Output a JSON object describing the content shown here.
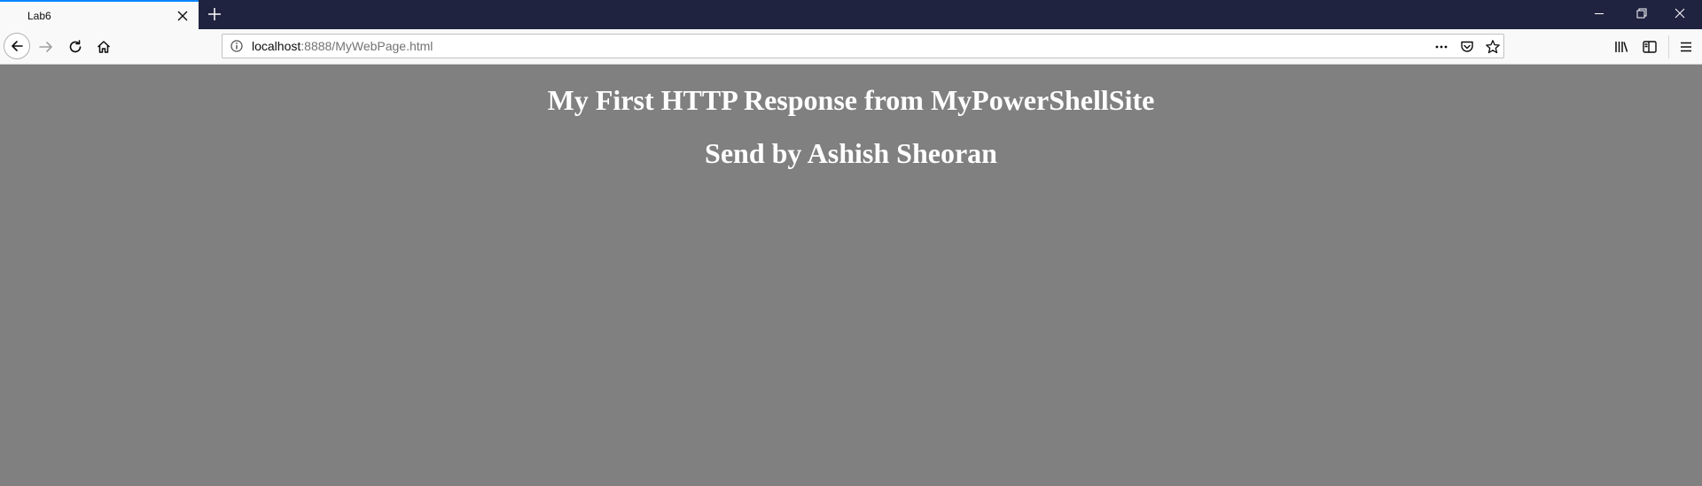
{
  "browser": {
    "tab": {
      "title": "Lab6"
    },
    "url": {
      "host": "localhost",
      "rest": ":8888/MyWebPage.html"
    },
    "colors": {
      "titlebar": "#202340",
      "tab_accent": "#0a84ff",
      "toolbar": "#f9f9fa"
    },
    "icons": {
      "tab_close": "close-icon",
      "new_tab": "plus-icon",
      "minimize": "minimize-icon",
      "restore": "restore-icon",
      "close": "close-icon",
      "back": "arrow-left-icon",
      "forward": "arrow-right-icon",
      "reload": "reload-icon",
      "home": "home-icon",
      "site_info": "info-icon",
      "page_actions": "more-horizontal-icon",
      "pocket": "pocket-icon",
      "bookmark": "star-icon",
      "library": "library-icon",
      "sidebar": "sidebar-icon",
      "menu": "hamburger-menu-icon"
    }
  },
  "page": {
    "background": "#808080",
    "heading_1": "My First HTTP Response from MyPowerShellSite",
    "heading_2": "Send by Ashish Sheoran"
  }
}
